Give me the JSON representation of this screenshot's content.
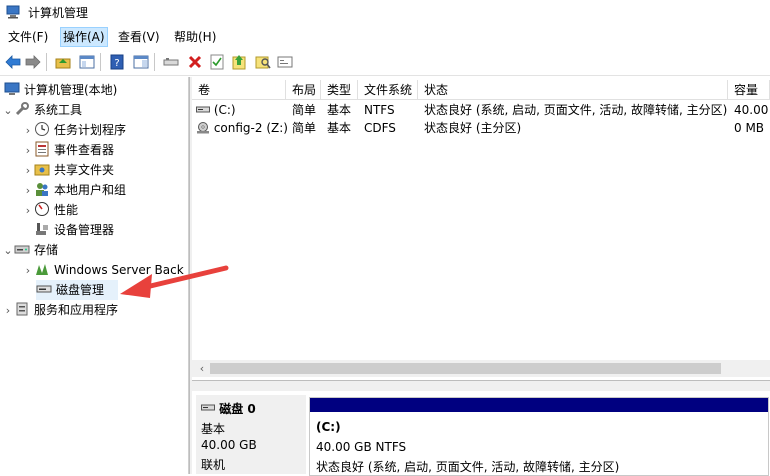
{
  "window": {
    "title": "计算机管理"
  },
  "menu": {
    "items": [
      "文件(F)",
      "操作(A)",
      "查看(V)",
      "帮助(H)"
    ],
    "active_index": 1
  },
  "toolbar": {
    "icons": [
      "back-arrow-icon",
      "forward-arrow-icon",
      "up-folder-icon",
      "show-hide-tree-icon",
      "help-icon",
      "properties-pane-icon",
      "connect-icon",
      "delete-icon",
      "checklist-icon",
      "export-icon",
      "search-drive-icon",
      "new-window-icon"
    ]
  },
  "tree": {
    "root": "计算机管理(本地)",
    "system_tools": "系统工具",
    "task_scheduler": "任务计划程序",
    "event_viewer": "事件查看器",
    "shared_folders": "共享文件夹",
    "local_users": "本地用户和组",
    "performance": "性能",
    "device_manager": "设备管理器",
    "storage": "存储",
    "windows_backup": "Windows Server Back",
    "disk_management": "磁盘管理",
    "services_apps": "服务和应用程序"
  },
  "volumes": {
    "columns": [
      "卷",
      "布局",
      "类型",
      "文件系统",
      "状态",
      "容量"
    ],
    "rows": [
      [
        "(C:)",
        "简单",
        "基本",
        "NTFS",
        "状态良好 (系统, 启动, 页面文件, 活动, 故障转储, 主分区)",
        "40.00"
      ],
      [
        "config-2 (Z:)",
        "简单",
        "基本",
        "CDFS",
        "状态良好 (主分区)",
        "0 MB"
      ]
    ]
  },
  "disk": {
    "name": "磁盘 0",
    "type": "基本",
    "size": "40.00 GB",
    "status": "联机",
    "volume_label": "(C:)",
    "volume_size": "40.00 GB NTFS",
    "volume_status": "状态良好 (系统, 启动, 页面文件, 活动, 故障转储, 主分区)"
  },
  "colors": {
    "accent": "#000080",
    "annotation": "#e8413c",
    "selection": "#cce8ff"
  }
}
